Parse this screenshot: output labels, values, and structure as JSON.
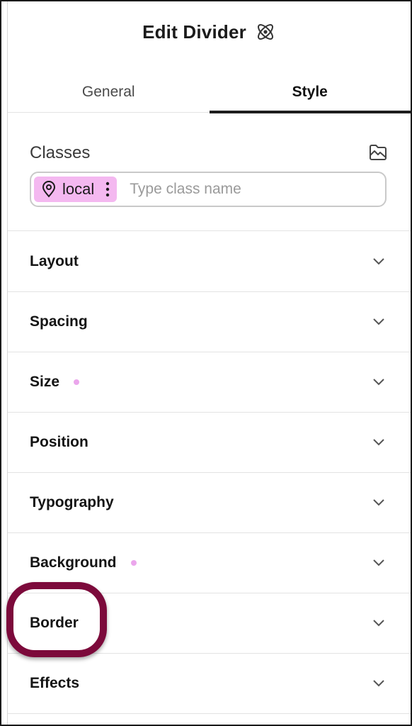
{
  "header": {
    "title": "Edit Divider",
    "icon": "atom-icon"
  },
  "tabs": [
    {
      "label": "General",
      "active": false
    },
    {
      "label": "Style",
      "active": true
    }
  ],
  "classes": {
    "label": "Classes",
    "chip": {
      "label": "local",
      "icon": "map-pin-icon"
    },
    "input_placeholder": "Type class name"
  },
  "sections": [
    {
      "label": "Layout",
      "dot": false
    },
    {
      "label": "Spacing",
      "dot": false
    },
    {
      "label": "Size",
      "dot": true
    },
    {
      "label": "Position",
      "dot": false
    },
    {
      "label": "Typography",
      "dot": false
    },
    {
      "label": "Background",
      "dot": true
    },
    {
      "label": "Border",
      "dot": false,
      "highlighted": true
    },
    {
      "label": "Effects",
      "dot": false
    }
  ],
  "colors": {
    "chip": "#f4b8f0",
    "dot": "#eba6ec",
    "highlight": "#7c0a3b",
    "active_tab_underline": "#1e1e1e"
  }
}
